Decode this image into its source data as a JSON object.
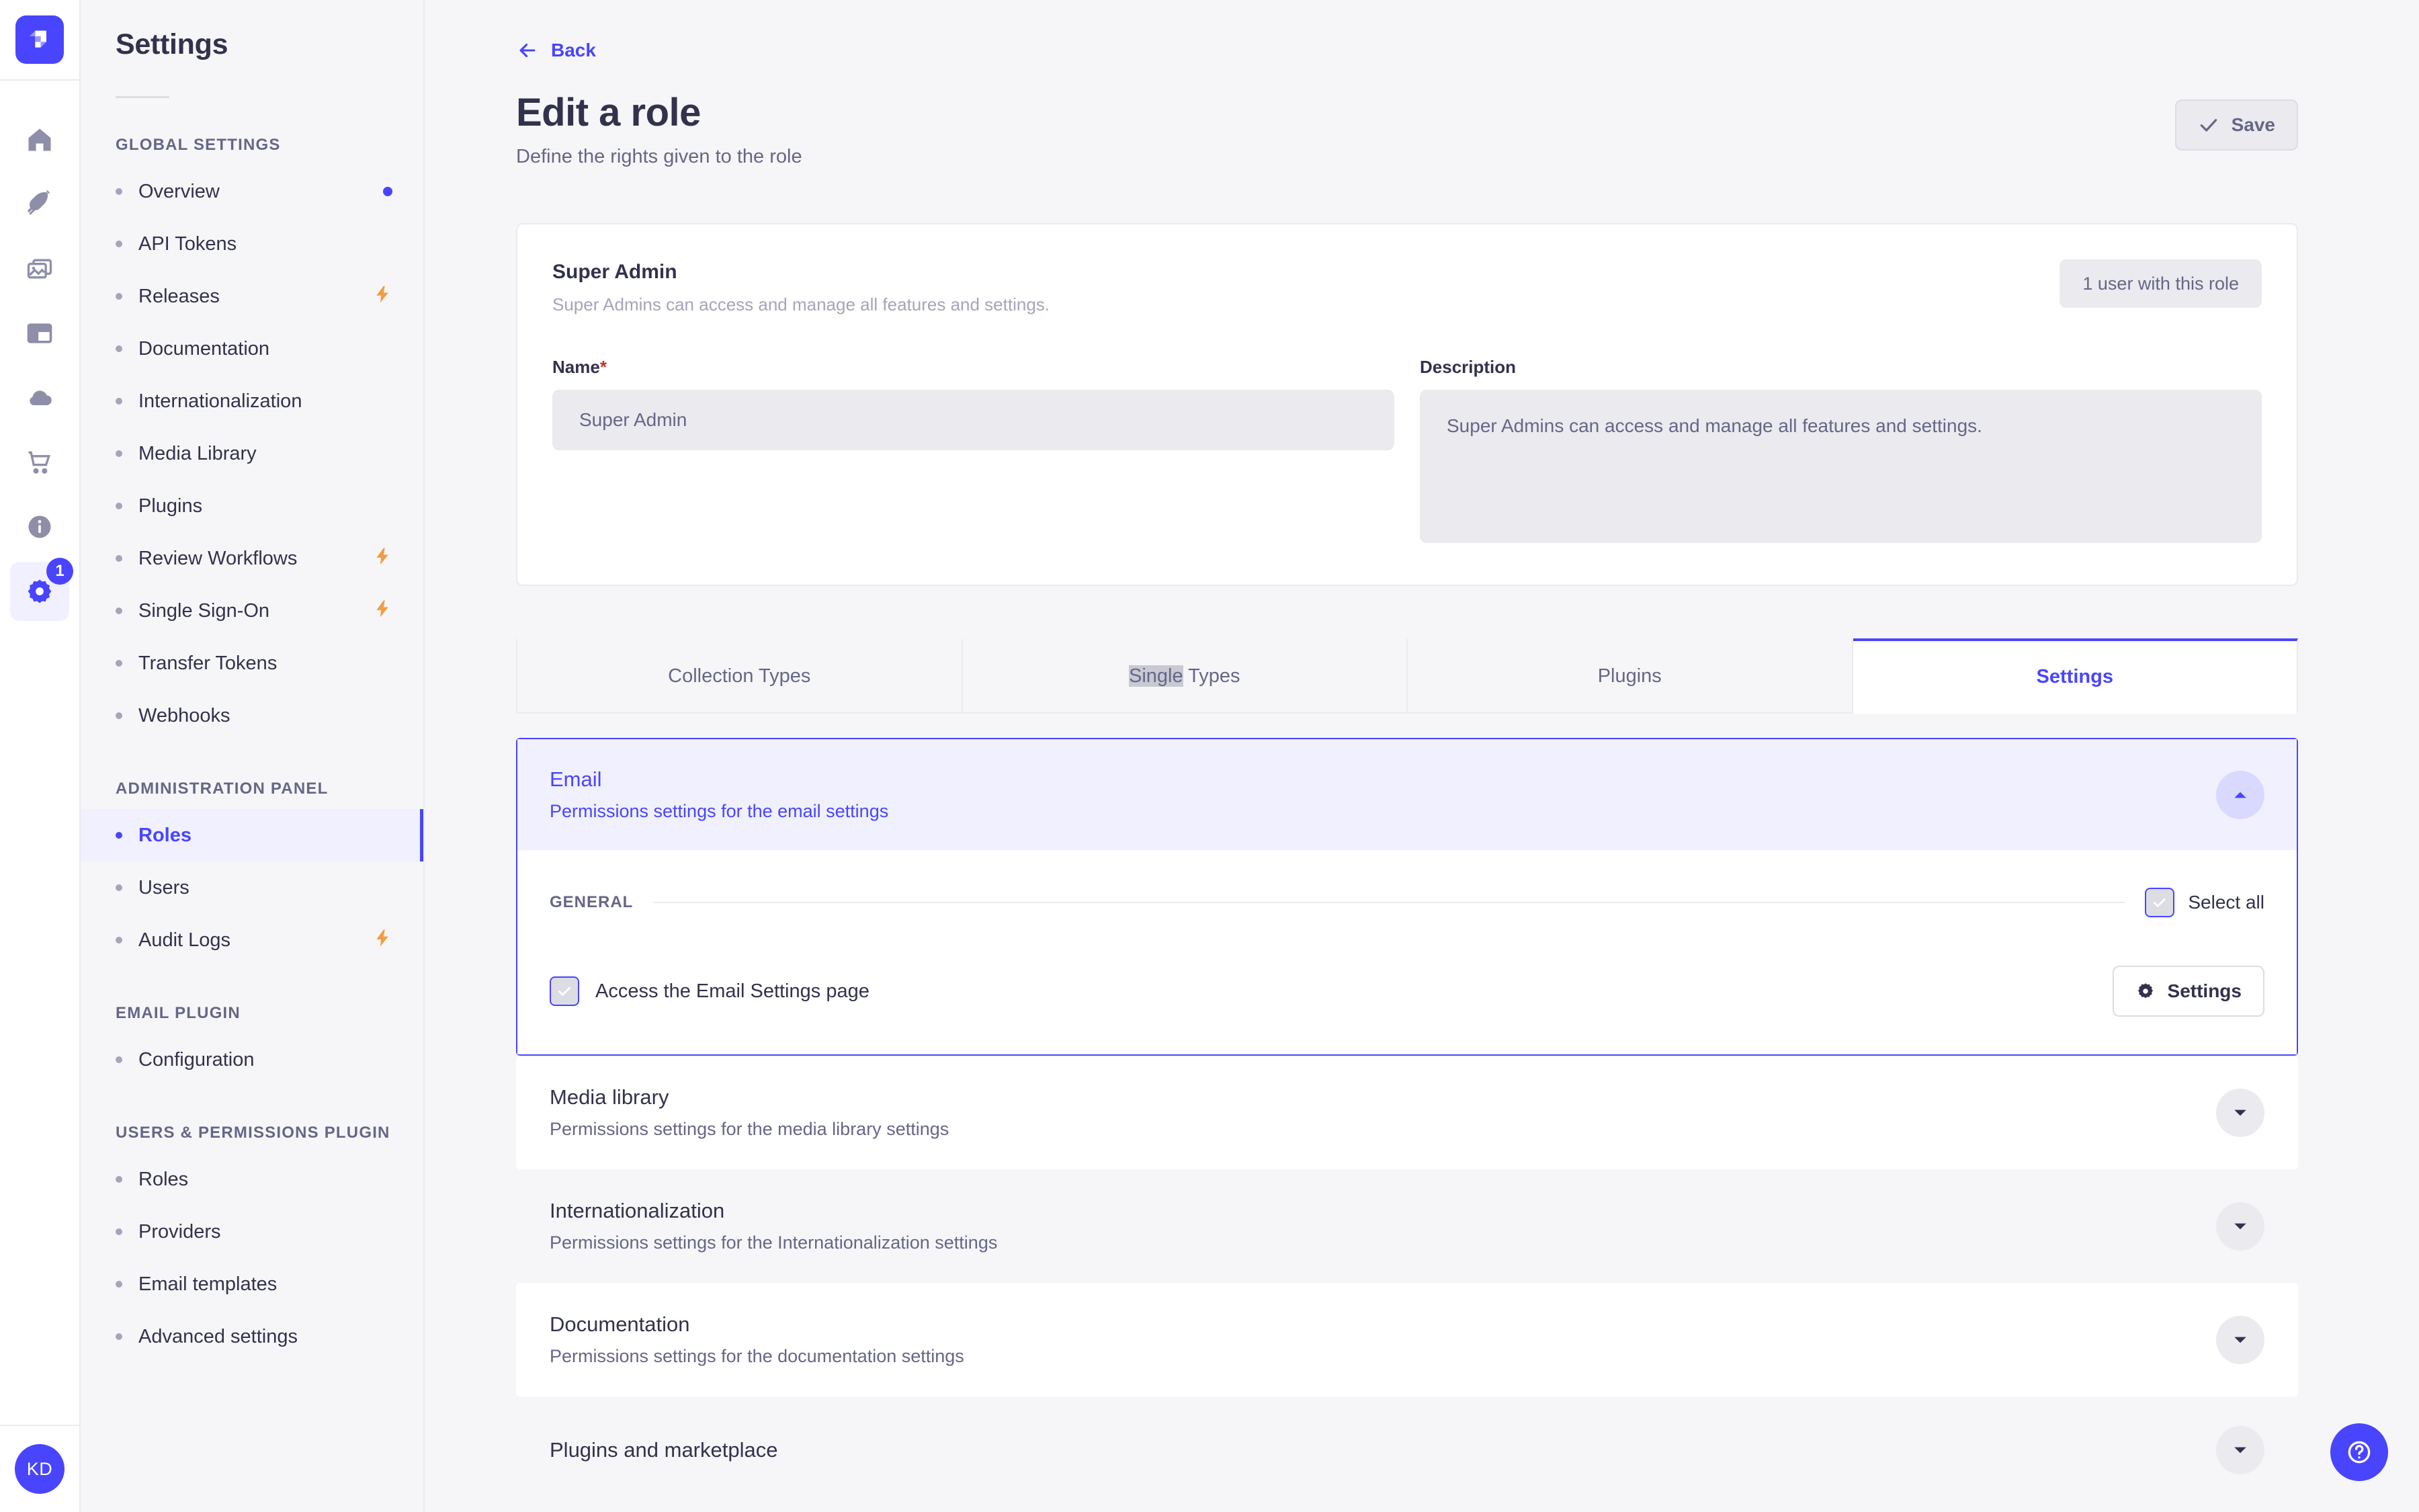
{
  "brand": {
    "accent": "#4945ff",
    "logo_icon": "strapi-logo-icon"
  },
  "rail": {
    "icons": [
      {
        "name": "home-icon",
        "label": "Home"
      },
      {
        "name": "feather-icon",
        "label": "Content Manager"
      },
      {
        "name": "image-icon",
        "label": "Media Library"
      },
      {
        "name": "layout-icon",
        "label": "Content-Type Builder"
      },
      {
        "name": "cloud-icon",
        "label": "Strapi Cloud"
      },
      {
        "name": "cart-icon",
        "label": "Marketplace"
      },
      {
        "name": "info-icon",
        "label": "Information"
      },
      {
        "name": "gear-icon",
        "label": "Settings"
      }
    ],
    "settings_badge": "1",
    "avatar_initials": "KD"
  },
  "sidebar": {
    "title": "Settings",
    "sections": [
      {
        "label": "GLOBAL SETTINGS",
        "items": [
          {
            "label": "Overview",
            "badge": "dot",
            "active": false
          },
          {
            "label": "API Tokens",
            "badge": "",
            "active": false
          },
          {
            "label": "Releases",
            "badge": "bolt",
            "active": false
          },
          {
            "label": "Documentation",
            "badge": "",
            "active": false
          },
          {
            "label": "Internationalization",
            "badge": "",
            "active": false
          },
          {
            "label": "Media Library",
            "badge": "",
            "active": false
          },
          {
            "label": "Plugins",
            "badge": "",
            "active": false
          },
          {
            "label": "Review Workflows",
            "badge": "bolt",
            "active": false
          },
          {
            "label": "Single Sign-On",
            "badge": "bolt",
            "active": false
          },
          {
            "label": "Transfer Tokens",
            "badge": "",
            "active": false
          },
          {
            "label": "Webhooks",
            "badge": "",
            "active": false
          }
        ]
      },
      {
        "label": "ADMINISTRATION PANEL",
        "items": [
          {
            "label": "Roles",
            "badge": "",
            "active": true
          },
          {
            "label": "Users",
            "badge": "",
            "active": false
          },
          {
            "label": "Audit Logs",
            "badge": "bolt",
            "active": false
          }
        ]
      },
      {
        "label": "EMAIL PLUGIN",
        "items": [
          {
            "label": "Configuration",
            "badge": "",
            "active": false
          }
        ]
      },
      {
        "label": "USERS & PERMISSIONS PLUGIN",
        "items": [
          {
            "label": "Roles",
            "badge": "",
            "active": false
          },
          {
            "label": "Providers",
            "badge": "",
            "active": false
          },
          {
            "label": "Email templates",
            "badge": "",
            "active": false
          },
          {
            "label": "Advanced settings",
            "badge": "",
            "active": false
          }
        ]
      }
    ]
  },
  "header": {
    "back_label": "Back",
    "title": "Edit a role",
    "subtitle": "Define the rights given to the role",
    "save_label": "Save"
  },
  "role_card": {
    "name": "Super Admin",
    "description": "Super Admins can access and manage all features and settings.",
    "users_badge": "1 user with this role",
    "name_field": {
      "label": "Name",
      "required_mark": "*",
      "value": "Super Admin"
    },
    "description_field": {
      "label": "Description",
      "value": "Super Admins can access and manage all features and settings."
    }
  },
  "tabs": [
    {
      "label": "Collection Types",
      "active": false,
      "selected_part": ""
    },
    {
      "label": "Single Types",
      "active": false,
      "selected_part": "Single"
    },
    {
      "label": "Plugins",
      "active": false,
      "selected_part": ""
    },
    {
      "label": "Settings",
      "active": true,
      "selected_part": ""
    }
  ],
  "permissions": {
    "expanded": {
      "name": "Email",
      "sub": "Permissions settings for the email settings",
      "general_label": "GENERAL",
      "select_all_label": "Select all",
      "select_all_checked": true,
      "rows": [
        {
          "label": "Access the Email Settings page",
          "checked": true,
          "settings_label": "Settings"
        }
      ]
    },
    "collapsed": [
      {
        "name": "Media library",
        "sub": "Permissions settings for the media library settings",
        "alt": false
      },
      {
        "name": "Internationalization",
        "sub": "Permissions settings for the Internationalization settings",
        "alt": true
      },
      {
        "name": "Documentation",
        "sub": "Permissions settings for the documentation settings",
        "alt": false
      },
      {
        "name": "Plugins and marketplace",
        "sub": "",
        "alt": true
      }
    ]
  },
  "help": {
    "icon": "question-mark-icon"
  }
}
